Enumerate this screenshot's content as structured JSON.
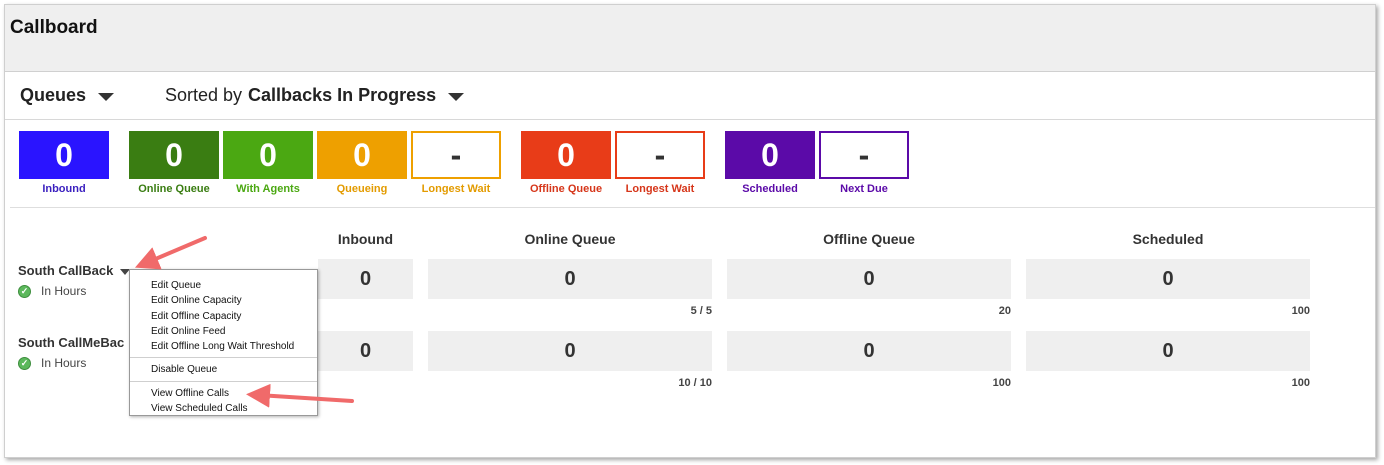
{
  "app": {
    "title": "Callboard"
  },
  "toolbar": {
    "queues_label": "Queues",
    "sorted_prefix": "Sorted by",
    "sorted_value": "Callbacks In Progress"
  },
  "tiles": [
    {
      "value": "0",
      "label": "Inbound",
      "color": "#2a14ff",
      "filled": true,
      "labelColor": "#3a1fbf"
    },
    {
      "value": "0",
      "label": "Online Queue",
      "color": "#3a7d12",
      "filled": true,
      "labelColor": "#3a7d12"
    },
    {
      "value": "0",
      "label": "With Agents",
      "color": "#4ba812",
      "filled": true,
      "labelColor": "#4ba812"
    },
    {
      "value": "0",
      "label": "Queueing",
      "color": "#eea000",
      "filled": true,
      "labelColor": "#e39b00"
    },
    {
      "value": "-",
      "label": "Longest Wait",
      "color": "#eea000",
      "filled": false,
      "labelColor": "#e39b00"
    },
    {
      "value": "0",
      "label": "Offline Queue",
      "color": "#e83c18",
      "filled": true,
      "labelColor": "#d6361a"
    },
    {
      "value": "-",
      "label": "Longest Wait",
      "color": "#e83c18",
      "filled": false,
      "labelColor": "#d6361a"
    },
    {
      "value": "0",
      "label": "Scheduled",
      "color": "#5b0aa8",
      "filled": true,
      "labelColor": "#5b0aa8"
    },
    {
      "value": "-",
      "label": "Next Due",
      "color": "#5b0aa8",
      "filled": false,
      "labelColor": "#5b0aa8"
    }
  ],
  "columns": [
    "Inbound",
    "Online Queue",
    "Offline Queue",
    "Scheduled"
  ],
  "queues": [
    {
      "name": "South CallBack",
      "status": "In Hours",
      "inbound": "0",
      "online": "0",
      "offline": "0",
      "scheduled": "0",
      "online_cap": "5 / 5",
      "offline_cap": "20",
      "scheduled_cap": "100"
    },
    {
      "name": "South CallMeBac",
      "status": "In Hours",
      "inbound": "0",
      "online": "0",
      "offline": "0",
      "scheduled": "0",
      "online_cap": "10 / 10",
      "offline_cap": "100",
      "scheduled_cap": "100"
    }
  ],
  "context_menu": {
    "group1": [
      "Edit Queue",
      "Edit Online Capacity",
      "Edit Offline Capacity",
      "Edit Online Feed",
      "Edit Offline Long Wait Threshold"
    ],
    "group2": [
      "Disable Queue"
    ],
    "group3": [
      "View Offline Calls",
      "View Scheduled Calls"
    ]
  },
  "annotation_color": "#f06a6a",
  "check_icon": "check-circle-icon"
}
